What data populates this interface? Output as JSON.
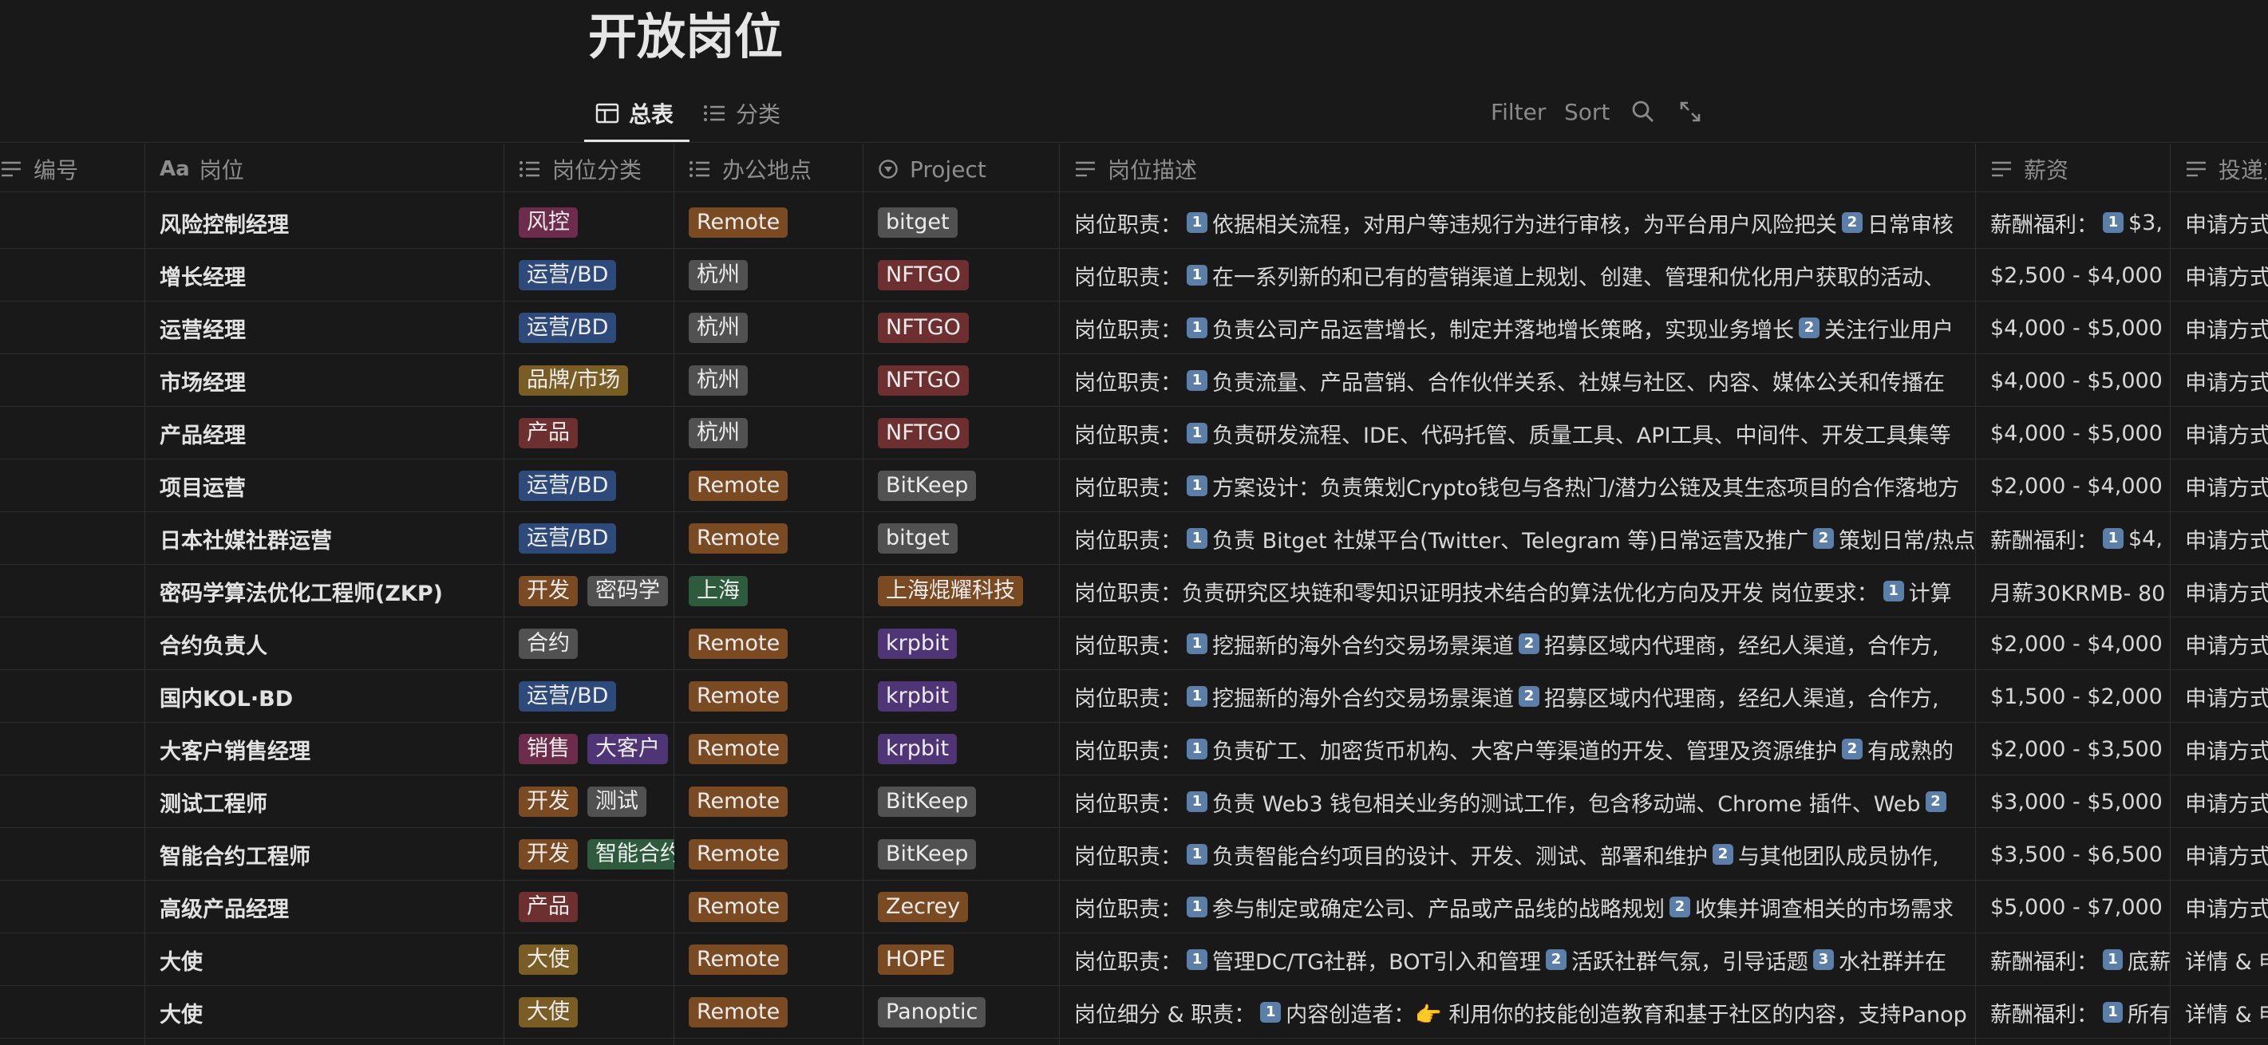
{
  "page": {
    "title": "开放岗位"
  },
  "tabs": [
    {
      "label": "总表",
      "active": true,
      "icon": "table-icon"
    },
    {
      "label": "分类",
      "active": false,
      "icon": "list-icon"
    }
  ],
  "toolbar": {
    "filter_label": "Filter",
    "sort_label": "Sort",
    "search_icon": "search-icon",
    "expand_icon": "expand-icon"
  },
  "columns": [
    {
      "label": "编号",
      "icon": "text-lines-icon"
    },
    {
      "label": "岗位",
      "icon": "aa-title-icon",
      "prefix": "Aa"
    },
    {
      "label": "岗位分类",
      "icon": "list-icon"
    },
    {
      "label": "办公地点",
      "icon": "list-icon"
    },
    {
      "label": "Project",
      "icon": "select-icon"
    },
    {
      "label": "岗位描述",
      "icon": "text-lines-icon"
    },
    {
      "label": "薪资",
      "icon": "text-lines-icon"
    },
    {
      "label": "投递方",
      "icon": "text-lines-icon"
    }
  ],
  "colors": {
    "red": "#6e2f31",
    "blue": "#2e4a7a",
    "brown": "#7a4a23",
    "gray": "#515151",
    "yellow": "#7a5d25",
    "green": "#2e5a3d",
    "purple": "#4f3576",
    "pink": "#6d2c4c"
  },
  "rows": [
    {
      "name": "风险控制经理",
      "cats": [
        {
          "t": "风控",
          "c": "pink"
        }
      ],
      "loc": {
        "t": "Remote",
        "c": "brown"
      },
      "proj": {
        "t": "bitget",
        "c": "gray"
      },
      "desc": [
        {
          "s": "岗位职责："
        },
        {
          "n": "1"
        },
        {
          "s": "依据相关流程，对用户等违规行为进行审核，为平台用户风险把关"
        },
        {
          "n": "2"
        },
        {
          "s": "日常审核"
        }
      ],
      "salary": [
        {
          "s": "薪酬福利："
        },
        {
          "n": "1"
        },
        {
          "s": "$3,"
        }
      ],
      "apply": "申请方式"
    },
    {
      "name": "增长经理",
      "cats": [
        {
          "t": "运营/BD",
          "c": "blue"
        }
      ],
      "loc": {
        "t": "杭州",
        "c": "gray"
      },
      "proj": {
        "t": "NFTGO",
        "c": "red"
      },
      "desc": [
        {
          "s": "岗位职责："
        },
        {
          "n": "1"
        },
        {
          "s": "在一系列新的和已有的营销渠道上规划、创建、管理和优化用户获取的活动、"
        }
      ],
      "salary": [
        {
          "s": "$2,500 - $4,000"
        }
      ],
      "apply": "申请方式"
    },
    {
      "name": "运营经理",
      "cats": [
        {
          "t": "运营/BD",
          "c": "blue"
        }
      ],
      "loc": {
        "t": "杭州",
        "c": "gray"
      },
      "proj": {
        "t": "NFTGO",
        "c": "red"
      },
      "desc": [
        {
          "s": "岗位职责："
        },
        {
          "n": "1"
        },
        {
          "s": "负责公司产品运营增长，制定并落地增长策略，实现业务增长"
        },
        {
          "n": "2"
        },
        {
          "s": "关注行业用户"
        }
      ],
      "salary": [
        {
          "s": "$4,000 - $5,000"
        }
      ],
      "apply": "申请方式"
    },
    {
      "name": "市场经理",
      "cats": [
        {
          "t": "品牌/市场",
          "c": "yellow"
        }
      ],
      "loc": {
        "t": "杭州",
        "c": "gray"
      },
      "proj": {
        "t": "NFTGO",
        "c": "red"
      },
      "desc": [
        {
          "s": "岗位职责："
        },
        {
          "n": "1"
        },
        {
          "s": "负责流量、产品营销、合作伙伴关系、社媒与社区、内容、媒体公关和传播在"
        }
      ],
      "salary": [
        {
          "s": "$4,000 - $5,000"
        }
      ],
      "apply": "申请方式"
    },
    {
      "name": "产品经理",
      "cats": [
        {
          "t": "产品",
          "c": "red"
        }
      ],
      "loc": {
        "t": "杭州",
        "c": "gray"
      },
      "proj": {
        "t": "NFTGO",
        "c": "red"
      },
      "desc": [
        {
          "s": "岗位职责："
        },
        {
          "n": "1"
        },
        {
          "s": "负责研发流程、IDE、代码托管、质量工具、API工具、中间件、开发工具集等"
        }
      ],
      "salary": [
        {
          "s": "$4,000 - $5,000"
        }
      ],
      "apply": "申请方式"
    },
    {
      "name": "项目运营",
      "cats": [
        {
          "t": "运营/BD",
          "c": "blue"
        }
      ],
      "loc": {
        "t": "Remote",
        "c": "brown"
      },
      "proj": {
        "t": "BitKeep",
        "c": "gray"
      },
      "desc": [
        {
          "s": "岗位职责："
        },
        {
          "n": "1"
        },
        {
          "s": "方案设计：负责策划Crypto钱包与各热门/潜力公链及其生态项目的合作落地方"
        }
      ],
      "salary": [
        {
          "s": "$2,000 - $4,000"
        }
      ],
      "apply": "申请方式"
    },
    {
      "name": "日本社媒社群运营",
      "cats": [
        {
          "t": "运营/BD",
          "c": "blue"
        }
      ],
      "loc": {
        "t": "Remote",
        "c": "brown"
      },
      "proj": {
        "t": "bitget",
        "c": "gray"
      },
      "desc": [
        {
          "s": "岗位职责："
        },
        {
          "n": "1"
        },
        {
          "s": "负责 Bitget 社媒平台(Twitter、Telegram 等)日常运营及推广"
        },
        {
          "n": "2"
        },
        {
          "s": "策划日常/热点"
        }
      ],
      "salary": [
        {
          "s": "薪酬福利："
        },
        {
          "n": "1"
        },
        {
          "s": "$4,"
        }
      ],
      "apply": "申请方式"
    },
    {
      "name": "密码学算法优化工程师(ZKP)",
      "cats": [
        {
          "t": "开发",
          "c": "brown"
        },
        {
          "t": "密码学",
          "c": "gray"
        }
      ],
      "loc": {
        "t": "上海",
        "c": "green"
      },
      "proj": {
        "t": "上海焜耀科技",
        "c": "brown"
      },
      "desc": [
        {
          "s": "岗位职责：负责研究区块链和零知识证明技术结合的算法优化方向及开发 岗位要求："
        },
        {
          "n": "1"
        },
        {
          "s": "计算"
        }
      ],
      "salary": [
        {
          "s": "月薪30KRMB- 80"
        }
      ],
      "apply": "申请方式"
    },
    {
      "name": "合约负责人",
      "cats": [
        {
          "t": "合约",
          "c": "gray"
        }
      ],
      "loc": {
        "t": "Remote",
        "c": "brown"
      },
      "proj": {
        "t": "krpbit",
        "c": "purple"
      },
      "desc": [
        {
          "s": "岗位职责："
        },
        {
          "n": "1"
        },
        {
          "s": "挖掘新的海外合约交易场景渠道"
        },
        {
          "n": "2"
        },
        {
          "s": "招募区域内代理商，经纪人渠道，合作方,"
        }
      ],
      "salary": [
        {
          "s": "$2,000 - $4,000"
        }
      ],
      "apply": "申请方式"
    },
    {
      "name": "国内KOL·BD",
      "cats": [
        {
          "t": "运营/BD",
          "c": "blue"
        }
      ],
      "loc": {
        "t": "Remote",
        "c": "brown"
      },
      "proj": {
        "t": "krpbit",
        "c": "purple"
      },
      "desc": [
        {
          "s": "岗位职责："
        },
        {
          "n": "1"
        },
        {
          "s": "挖掘新的海外合约交易场景渠道"
        },
        {
          "n": "2"
        },
        {
          "s": "招募区域内代理商，经纪人渠道，合作方,"
        }
      ],
      "salary": [
        {
          "s": "$1,500 - $2,000"
        }
      ],
      "apply": "申请方式"
    },
    {
      "name": "大客户销售经理",
      "cats": [
        {
          "t": "销售",
          "c": "pink"
        },
        {
          "t": "大客户",
          "c": "purple"
        }
      ],
      "loc": {
        "t": "Remote",
        "c": "brown"
      },
      "proj": {
        "t": "krpbit",
        "c": "purple"
      },
      "desc": [
        {
          "s": "岗位职责："
        },
        {
          "n": "1"
        },
        {
          "s": "负责矿工、加密货币机构、大客户等渠道的开发、管理及资源维护"
        },
        {
          "n": "2"
        },
        {
          "s": "有成熟的"
        }
      ],
      "salary": [
        {
          "s": "$2,000 - $3,500"
        }
      ],
      "apply": "申请方式"
    },
    {
      "name": "测试工程师",
      "cats": [
        {
          "t": "开发",
          "c": "brown"
        },
        {
          "t": "测试",
          "c": "gray"
        }
      ],
      "loc": {
        "t": "Remote",
        "c": "brown"
      },
      "proj": {
        "t": "BitKeep",
        "c": "gray"
      },
      "desc": [
        {
          "s": "岗位职责："
        },
        {
          "n": "1"
        },
        {
          "s": "负责 Web3 钱包相关业务的测试工作，包含移动端、Chrome 插件、Web"
        },
        {
          "n": "2"
        }
      ],
      "salary": [
        {
          "s": "$3,000 - $5,000"
        }
      ],
      "apply": "申请方式"
    },
    {
      "name": "智能合约工程师",
      "cats": [
        {
          "t": "开发",
          "c": "brown"
        },
        {
          "t": "智能合约",
          "c": "green"
        }
      ],
      "loc": {
        "t": "Remote",
        "c": "brown"
      },
      "proj": {
        "t": "BitKeep",
        "c": "gray"
      },
      "desc": [
        {
          "s": "岗位职责："
        },
        {
          "n": "1"
        },
        {
          "s": "负责智能合约项目的设计、开发、测试、部署和维护"
        },
        {
          "n": "2"
        },
        {
          "s": "与其他团队成员协作,"
        }
      ],
      "salary": [
        {
          "s": "$3,500 - $6,500"
        }
      ],
      "apply": "申请方式"
    },
    {
      "name": "高级产品经理",
      "cats": [
        {
          "t": "产品",
          "c": "red"
        }
      ],
      "loc": {
        "t": "Remote",
        "c": "brown"
      },
      "proj": {
        "t": "Zecrey",
        "c": "brown"
      },
      "desc": [
        {
          "s": "岗位职责："
        },
        {
          "n": "1"
        },
        {
          "s": "参与制定或确定公司、产品或产品线的战略规划"
        },
        {
          "n": "2"
        },
        {
          "s": "收集并调查相关的市场需求"
        }
      ],
      "salary": [
        {
          "s": "$5,000 - $7,000"
        }
      ],
      "apply": "申请方式"
    },
    {
      "name": "大使",
      "cats": [
        {
          "t": "大使",
          "c": "yellow"
        }
      ],
      "loc": {
        "t": "Remote",
        "c": "brown"
      },
      "proj": {
        "t": "HOPE",
        "c": "brown"
      },
      "desc": [
        {
          "s": "岗位职责："
        },
        {
          "n": "1"
        },
        {
          "s": "管理DC/TG社群，BOT引入和管理"
        },
        {
          "n": "2"
        },
        {
          "s": "活跃社群气氛，引导话题"
        },
        {
          "n": "3"
        },
        {
          "s": "水社群并在"
        }
      ],
      "salary": [
        {
          "s": "薪酬福利："
        },
        {
          "n": "1"
        },
        {
          "s": "底薪"
        }
      ],
      "apply": "详情 & 申"
    },
    {
      "name": "大使",
      "cats": [
        {
          "t": "大使",
          "c": "yellow"
        }
      ],
      "loc": {
        "t": "Remote",
        "c": "brown"
      },
      "proj": {
        "t": "Panoptic",
        "c": "gray"
      },
      "desc": [
        {
          "s": "岗位细分 & 职责："
        },
        {
          "n": "1"
        },
        {
          "s": "内容创造者：👉 利用你的技能创造教育和基于社区的内容，支持Panop"
        }
      ],
      "salary": [
        {
          "s": "薪酬福利："
        },
        {
          "n": "1"
        },
        {
          "s": "所有"
        }
      ],
      "apply": "详情 & 申"
    }
  ]
}
